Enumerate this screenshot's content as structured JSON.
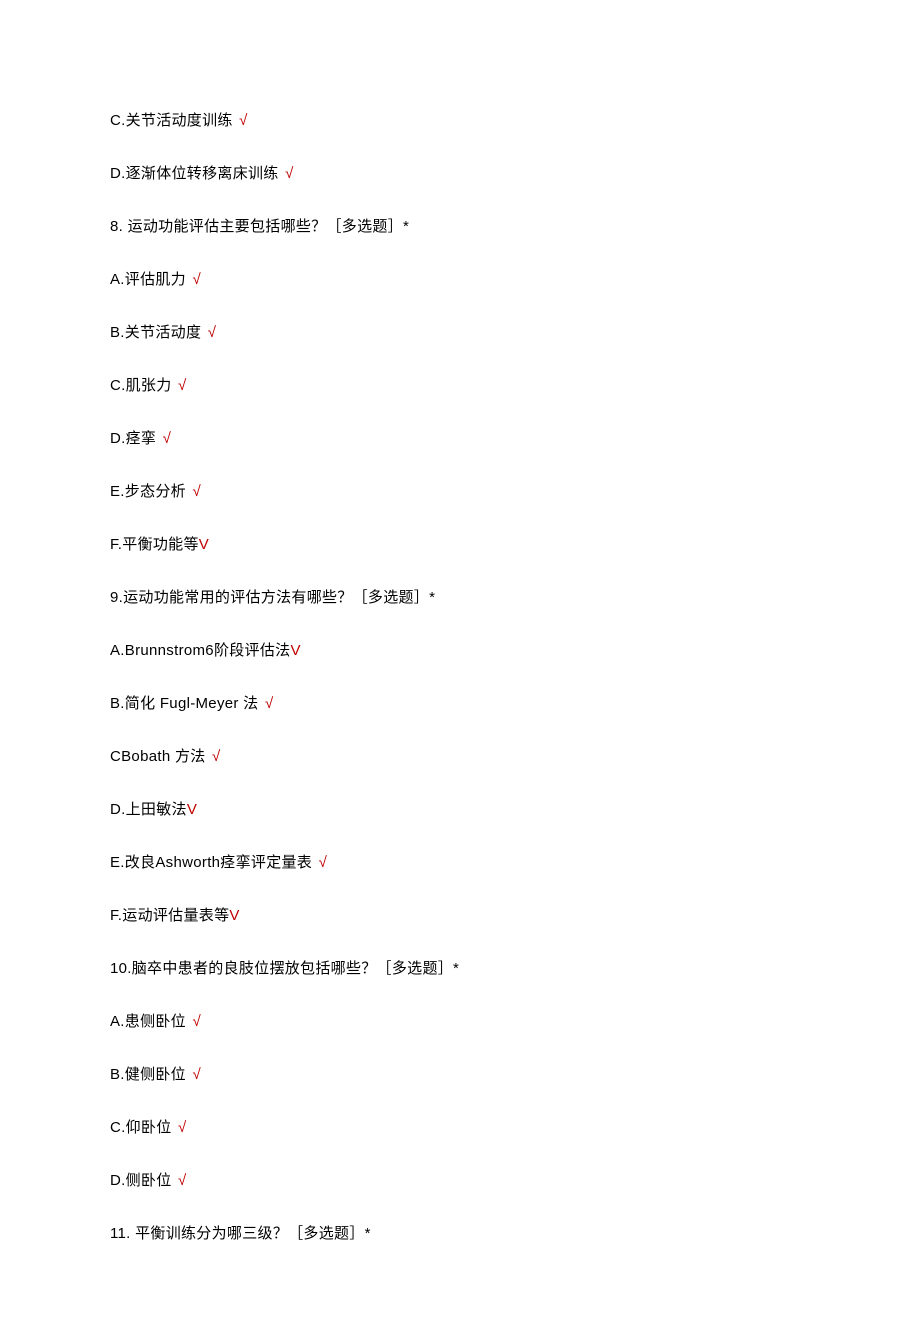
{
  "marks": {
    "check": "√",
    "v": "V"
  },
  "lines": [
    {
      "text": "C.关节活动度训练 ",
      "mark": "check"
    },
    {
      "text": "D.逐渐体位转移离床训练 ",
      "mark": "check"
    },
    {
      "text": "8. 运动功能评估主要包括哪些？［多选题］*",
      "mark": null
    },
    {
      "text": "A.评估肌力 ",
      "mark": "check"
    },
    {
      "text": "B.关节活动度 ",
      "mark": "check"
    },
    {
      "text": "C.肌张力 ",
      "mark": "check"
    },
    {
      "text": "D.痉挛 ",
      "mark": "check"
    },
    {
      "text": "E.步态分析 ",
      "mark": "check"
    },
    {
      "text": "F.平衡功能等",
      "mark": "v"
    },
    {
      "text": "9.运动功能常用的评估方法有哪些？［多选题］*",
      "mark": null
    },
    {
      "text": "A.Brunnstrom6阶段评估法",
      "mark": "v"
    },
    {
      "text": "B.简化 Fugl-Meyer 法  ",
      "mark": "check"
    },
    {
      "text": "CBobath 方法  ",
      "mark": "check"
    },
    {
      "text": "D.上田敏法",
      "mark": "v"
    },
    {
      "text": "E.改良Ashworth痉挛评定量表 ",
      "mark": "check"
    },
    {
      "text": "F.运动评估量表等",
      "mark": "v"
    },
    {
      "text": "10.脑卒中患者的良肢位摆放包括哪些？［多选题］*",
      "mark": null
    },
    {
      "text": "A.患侧卧位 ",
      "mark": "check"
    },
    {
      "text": "B.健侧卧位 ",
      "mark": "check"
    },
    {
      "text": "C.仰卧位 ",
      "mark": "check"
    },
    {
      "text": "D.侧卧位 ",
      "mark": "check"
    },
    {
      "text": "11. 平衡训练分为哪三级？［多选题］*",
      "mark": null
    }
  ]
}
